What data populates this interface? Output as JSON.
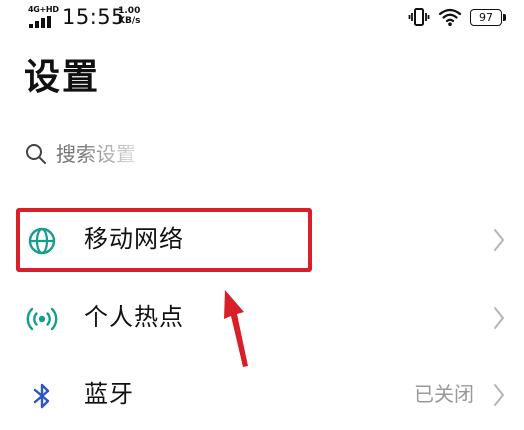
{
  "status_bar": {
    "network_type": "4G+HD",
    "time": "15:55",
    "speed_value": "1.00",
    "speed_unit": "KB/s",
    "battery": "97",
    "icons": [
      "signal-bars-icon",
      "vibrate-icon",
      "wifi-icon",
      "battery-icon"
    ]
  },
  "page": {
    "title": "设置"
  },
  "search": {
    "placeholder": "搜索设置",
    "icon": "search-icon"
  },
  "settings_list": {
    "items": [
      {
        "label": "移动网络",
        "icon": "globe-icon",
        "value": "",
        "highlighted": true
      },
      {
        "label": "个人热点",
        "icon": "hotspot-icon",
        "value": ""
      },
      {
        "label": "蓝牙",
        "icon": "bluetooth-icon",
        "value": "已关闭"
      }
    ]
  },
  "annotation": {
    "color": "#d8202a",
    "shapes": [
      "highlight-box",
      "pointer-arrow"
    ]
  },
  "colors": {
    "accent": "#159e8e",
    "bluetooth": "#2a54c8",
    "annotation": "#d8202a"
  }
}
